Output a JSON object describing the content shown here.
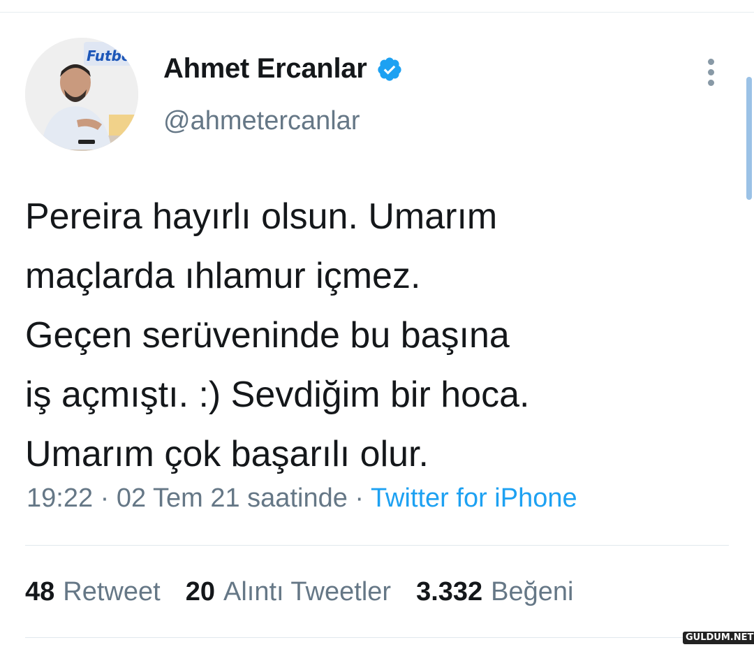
{
  "profile": {
    "display_name": "Ahmet Ercanlar",
    "handle": "@ahmetercanlar",
    "avatar_logo_text": "Futbol"
  },
  "tweet": {
    "text": "Pereira hayırlı olsun. Umarım\nmaçlarda ıhlamur içmez.\nGeçen serüveninde bu başına\niş açmıştı. :) Sevdiğim bir hoca.\nUmarım çok başarılı olur.",
    "time": "19:22 · 02 Tem 21 saatinde · ",
    "source": "Twitter for iPhone"
  },
  "stats": {
    "retweets": {
      "count": "48",
      "label": "Retweet"
    },
    "quotes": {
      "count": "20",
      "label": "Alıntı Tweetler"
    },
    "likes": {
      "count": "3.332",
      "label": "Beğeni"
    }
  },
  "watermark": "GULDUM.NET",
  "colors": {
    "text": "#14171a",
    "secondary": "#657786",
    "accent": "#1da1f2",
    "divider": "#e1e8ed"
  },
  "icons": {
    "verified": "verified-badge-icon",
    "more": "vertical-ellipsis-icon"
  }
}
